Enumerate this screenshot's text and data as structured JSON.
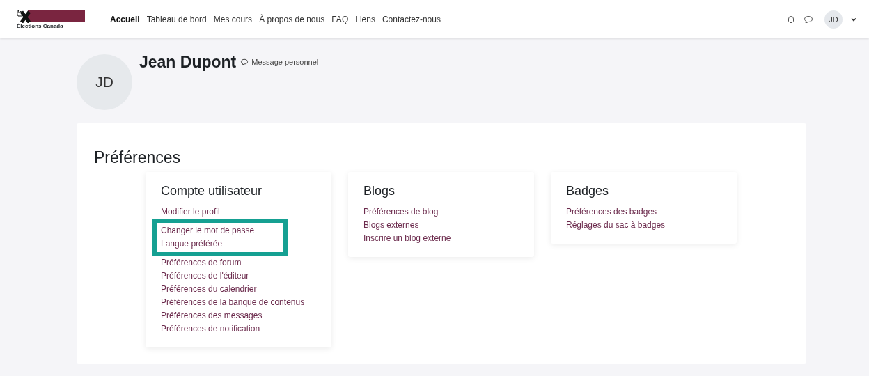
{
  "navbar": {
    "logo_text": "Élections Canada",
    "links": [
      {
        "label": "Accueil",
        "selected": true
      },
      {
        "label": "Tableau de bord",
        "selected": false
      },
      {
        "label": "Mes cours",
        "selected": false
      },
      {
        "label": "À propos de nous",
        "selected": false
      },
      {
        "label": "FAQ",
        "selected": false
      },
      {
        "label": "Liens",
        "selected": false
      },
      {
        "label": "Contactez-nous",
        "selected": false
      }
    ],
    "user_initials": "JD"
  },
  "profile": {
    "initials": "JD",
    "name": "Jean Dupont",
    "message_link": "Message personnel"
  },
  "preferences": {
    "title": "Préférences",
    "cards": [
      {
        "title": "Compte utilisateur",
        "links": [
          {
            "label": "Modifier le profil",
            "highlighted": false
          },
          {
            "label": "Changer le mot de passe",
            "highlighted": true
          },
          {
            "label": "Langue préférée",
            "highlighted": true
          },
          {
            "label": "Préférences de forum",
            "highlighted": false
          },
          {
            "label": "Préférences de l'éditeur",
            "highlighted": false
          },
          {
            "label": "Préférences du calendrier",
            "highlighted": false
          },
          {
            "label": "Préférences de la banque de contenus",
            "highlighted": false
          },
          {
            "label": "Préférences des messages",
            "highlighted": false
          },
          {
            "label": "Préférences de notification",
            "highlighted": false
          }
        ]
      },
      {
        "title": "Blogs",
        "links": [
          {
            "label": "Préférences de blog",
            "highlighted": false
          },
          {
            "label": "Blogs externes",
            "highlighted": false
          },
          {
            "label": "Inscrire un blog externe",
            "highlighted": false
          }
        ]
      },
      {
        "title": "Badges",
        "links": [
          {
            "label": "Préférences des badges",
            "highlighted": false
          },
          {
            "label": "Réglages du sac à badges",
            "highlighted": false
          }
        ]
      }
    ]
  }
}
